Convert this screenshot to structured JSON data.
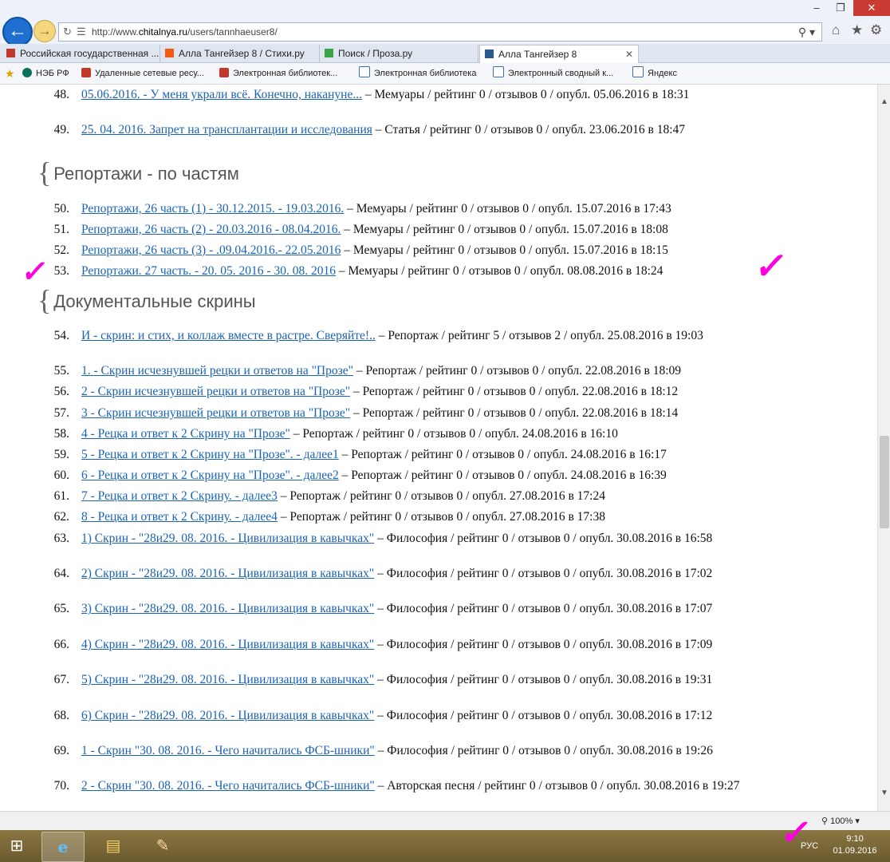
{
  "browser": {
    "url_prefix": "http://www.",
    "url_domain": "chitalnya.ru",
    "url_path": "/users/tannhaeuser8/",
    "tabs": [
      {
        "label": "Российская государственная ...",
        "color": "#c0392b"
      },
      {
        "label": "Алла Тангейзер 8 / Стихи.ру",
        "color": "#f05a14"
      },
      {
        "label": "Поиск / Проза.ру",
        "color": "#3aa545"
      },
      {
        "label": "Алла Тангейзер 8",
        "color": "#2a5a8e"
      }
    ],
    "favorites": [
      "НЭБ РФ",
      "Удаленные сетевые ресу...",
      "Электронная библиотек...",
      "Электронная библиотека",
      "Электронный сводный к...",
      "Яндекс"
    ]
  },
  "sections": [
    {
      "title": "Репортажи - по частям"
    },
    {
      "title": "Документальные скрины"
    }
  ],
  "items": [
    {
      "num": "48.",
      "link": "05.06.2016. - У меня украли всё. Конечно, накануне...",
      "meta": " – Мемуары / рейтинг 0 / отзывов 0 / опубл. 05.06.2016 в 18:31"
    },
    {
      "num": "49.",
      "link": "25. 04. 2016. Запрет на трансплантации и исследования",
      "meta": " – Статья / рейтинг 0 / отзывов 0 / опубл. 23.06.2016 в 18:47"
    },
    {
      "num": "50.",
      "link": "Репортажи, 26 часть (1) - 30.12.2015. - 19.03.2016.",
      "meta": " – Мемуары / рейтинг 0 / отзывов 0 / опубл. 15.07.2016 в 17:43"
    },
    {
      "num": "51.",
      "link": "Репортажи, 26 часть (2) - 20.03.2016 - 08.04.2016.",
      "meta": " – Мемуары / рейтинг 0 / отзывов 0 / опубл. 15.07.2016 в 18:08"
    },
    {
      "num": "52.",
      "link": "Репортажи, 26 часть (3) - .09.04.2016.- 22.05.2016",
      "meta": " – Мемуары / рейтинг 0 / отзывов 0 / опубл. 15.07.2016 в 18:15"
    },
    {
      "num": "53.",
      "link": "Репортажи. 27 часть. - 20. 05. 2016 - 30. 08. 2016",
      "meta": " – Мемуары / рейтинг 0 / отзывов 0 / опубл. 08.08.2016 в 18:24"
    },
    {
      "num": "54.",
      "link": "И - скрин: и стих, и коллаж вместе в растре. Сверяйте!..",
      "meta": " – Репортаж / рейтинг 5 / отзывов 2 / опубл. 25.08.2016 в 19:03"
    },
    {
      "num": "55.",
      "link": "1. - Скрин исчезнувшей рецки и ответов на \"Прозе\"",
      "meta": " – Репортаж / рейтинг 0 / отзывов 0 / опубл. 22.08.2016 в 18:09"
    },
    {
      "num": "56.",
      "link": "2 - Скрин исчезнувшей рецки и ответов на \"Прозе\"",
      "meta": " – Репортаж / рейтинг 0 / отзывов 0 / опубл. 22.08.2016 в 18:12"
    },
    {
      "num": "57.",
      "link": "3 - Скрин исчезнувшей рецки и ответов на \"Прозе\"",
      "meta": " – Репортаж / рейтинг 0 / отзывов 0 / опубл. 22.08.2016 в 18:14"
    },
    {
      "num": "58.",
      "link": "4 - Рецка и ответ к 2 Скрину на \"Прозе\"",
      "meta": " – Репортаж / рейтинг 0 / отзывов 0 / опубл. 24.08.2016 в 16:10"
    },
    {
      "num": "59.",
      "link": "5 - Рецка и ответ к 2 Скрину на \"Прозе\". - далее1",
      "meta": " – Репортаж / рейтинг 0 / отзывов 0 / опубл. 24.08.2016 в 16:17"
    },
    {
      "num": "60.",
      "link": "6 - Рецка и ответ к 2 Скрину на \"Прозе\". - далее2",
      "meta": " – Репортаж / рейтинг 0 / отзывов 0 / опубл. 24.08.2016 в 16:39"
    },
    {
      "num": "61.",
      "link": "7 - Рецка и ответ к 2 Скрину. - далее3",
      "meta": " – Репортаж / рейтинг 0 / отзывов 0 / опубл. 27.08.2016 в 17:24"
    },
    {
      "num": "62.",
      "link": "8 - Рецка и ответ к 2 Скрину. - далее4",
      "meta": " – Репортаж / рейтинг 0 / отзывов 0 / опубл. 27.08.2016 в 17:38"
    },
    {
      "num": "63.",
      "link": "1) Скрин - \"28и29. 08. 2016. - Цивилизация в кавычках\"",
      "meta": " – Философия / рейтинг 0 / отзывов 0 / опубл. 30.08.2016 в 16:58"
    },
    {
      "num": "64.",
      "link": "2) Скрин - \"28и29. 08. 2016. - Цивилизация в кавычках\"",
      "meta": " – Философия / рейтинг 0 / отзывов 0 / опубл. 30.08.2016 в 17:02"
    },
    {
      "num": "65.",
      "link": "3) Скрин - \"28и29. 08. 2016. - Цивилизация в кавычках\"",
      "meta": " – Философия / рейтинг 0 / отзывов 0 / опубл. 30.08.2016 в 17:07"
    },
    {
      "num": "66.",
      "link": "4) Скрин - \"28и29. 08. 2016. - Цивилизация в кавычках\"",
      "meta": " – Философия / рейтинг 0 / отзывов 0 / опубл. 30.08.2016 в 17:09"
    },
    {
      "num": "67.",
      "link": "5) Скрин - \"28и29. 08. 2016. - Цивилизация в кавычках\"",
      "meta": " – Философия / рейтинг 0 / отзывов 0 / опубл. 30.08.2016 в 19:31"
    },
    {
      "num": "68.",
      "link": "6) Скрин - \"28и29. 08. 2016. - Цивилизация в кавычках\"",
      "meta": " – Философия / рейтинг 0 / отзывов 0 / опубл. 30.08.2016 в 17:12"
    },
    {
      "num": "69.",
      "link": "1 - Скрин \"30. 08. 2016. - Чего начитались ФСБ-шники\"",
      "meta": " – Философия / рейтинг 0 / отзывов 0 / опубл. 30.08.2016 в 19:26"
    },
    {
      "num": "70.",
      "link": "2 - Скрин \"30. 08. 2016. - Чего начитались ФСБ-шники\"",
      "meta": " – Авторская песня / рейтинг 0 / отзывов 0 / опубл. 30.08.2016 в 19:27"
    }
  ],
  "status": {
    "zoom": "100%"
  },
  "taskbar": {
    "lang": "РУС",
    "time": "9:10",
    "date": "01.09.2016"
  }
}
